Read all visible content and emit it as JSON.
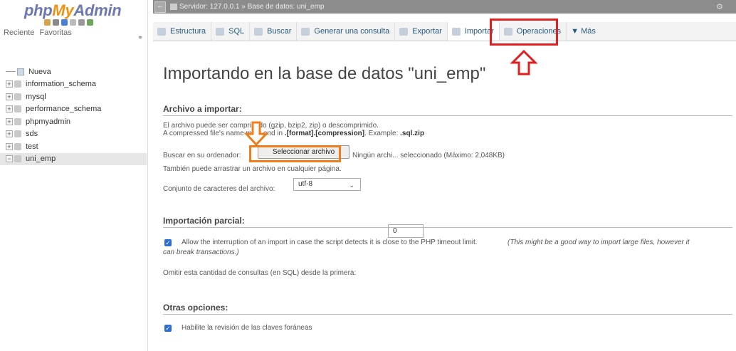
{
  "sidebar": {
    "logo_php": "php",
    "logo_my": "My",
    "logo_admin": "Admin",
    "tab_recent": "Reciente",
    "tab_favorites": "Favoritas",
    "new_label": "Nueva",
    "databases": [
      "information_schema",
      "mysql",
      "performance_schema",
      "phpmyadmin",
      "sds",
      "test",
      "uni_emp"
    ],
    "active_db": "uni_emp"
  },
  "topbar": {
    "breadcrumb": "Servidor: 127.0.0.1 » Base de datos: uni_emp"
  },
  "menu": {
    "tabs": [
      {
        "label": "Estructura",
        "icon": "structure-icon"
      },
      {
        "label": "SQL",
        "icon": "sql-icon"
      },
      {
        "label": "Buscar",
        "icon": "search-icon"
      },
      {
        "label": "Generar una consulta",
        "icon": "query-icon"
      },
      {
        "label": "Exportar",
        "icon": "export-icon"
      },
      {
        "label": "Importar",
        "icon": "import-icon"
      },
      {
        "label": "Operaciones",
        "icon": "wrench-icon"
      },
      {
        "label": "▼ Más",
        "icon": ""
      }
    ],
    "active": "Importar"
  },
  "main": {
    "title": "Importando en la base de datos \"uni_emp\"",
    "file_section": {
      "title": "Archivo a importar:",
      "line1": "El archivo puede ser comprimido (gzip, bzip2, zip) o descomprimido.",
      "line2_pre": "A compressed file's name must end in ",
      "line2_bold": ".[format].[compression]",
      "line2_mid": ". Example: ",
      "line2_example": ".sql.zip",
      "browse_label": "Buscar en su ordenador:",
      "browse_button": "Seleccionar archivo",
      "no_file": "Ningún archi... seleccionado",
      "max_size": "(Máximo: 2,048KB)",
      "drag_text": "También puede arrastrar un archivo en cualquier página.",
      "charset_label": "Conjunto de caracteres del archivo:",
      "charset_value": "utf-8"
    },
    "partial_section": {
      "title": "Importación parcial:",
      "allow_text": "Allow the interruption of an import in case the script detects it is close to the PHP timeout limit.",
      "allow_note": "(This might be a good way to import large files, however it can break transactions.)",
      "allow_checked": true,
      "skip_label": "Omitir esta cantidad de consultas (en SQL) desde la primera:",
      "skip_value": "0"
    },
    "other_section": {
      "title": "Otras opciones:",
      "fk_label": "Habilite la revisión de las claves foráneas",
      "fk_checked": true
    }
  },
  "colors": {
    "highlight_red": "#e02020",
    "highlight_orange": "#f07c1a",
    "link_blue": "#235a81",
    "checkbox_blue": "#2b6ed6"
  }
}
